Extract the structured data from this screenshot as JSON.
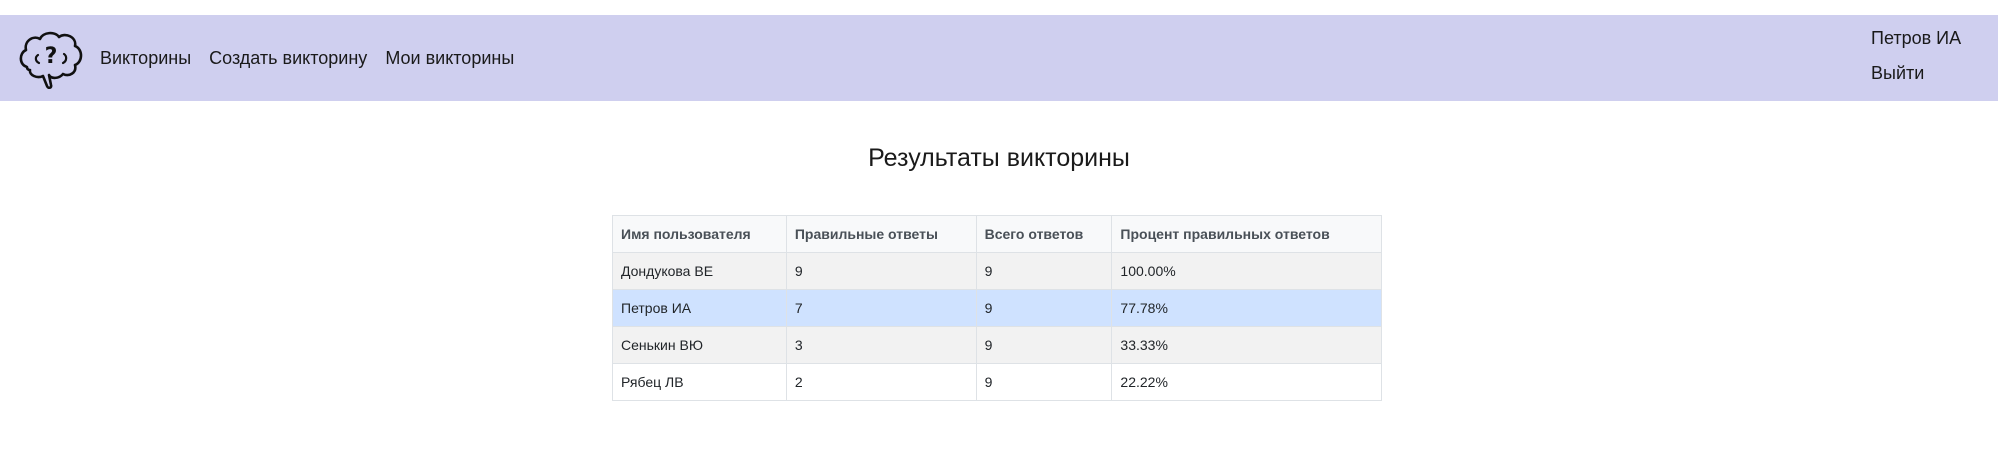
{
  "nav": {
    "logo_icon": "brain-question-icon",
    "links": [
      "Викторины",
      "Создать викторину",
      "Мои викторины"
    ],
    "user_name": "Петров ИА",
    "logout_label": "Выйти",
    "background_color": "#cfcfef"
  },
  "page": {
    "title": "Результаты викторины"
  },
  "results_table": {
    "headers": [
      "Имя пользователя",
      "Правильные ответы",
      "Всего ответов",
      "Процент правильных ответов"
    ],
    "rows": [
      [
        "Дондукова ВЕ",
        "9",
        "9",
        "100.00%"
      ],
      [
        "Петров ИА",
        "7",
        "9",
        "77.78%"
      ],
      [
        "Сенькин ВЮ",
        "3",
        "9",
        "33.33%"
      ],
      [
        "Рябец ЛВ",
        "2",
        "9",
        "22.22%"
      ]
    ],
    "highlighted_row_index": 1,
    "highlight_color": "#cfe2ff"
  }
}
